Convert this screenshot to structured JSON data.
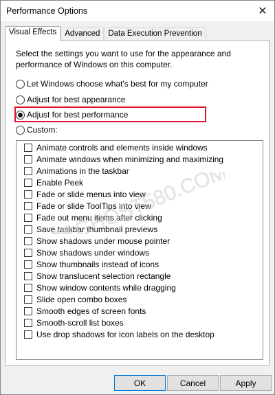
{
  "window": {
    "title": "Performance Options",
    "close_glyph": "✕"
  },
  "tabs": [
    {
      "label": "Visual Effects",
      "active": true
    },
    {
      "label": "Advanced",
      "active": false
    },
    {
      "label": "Data Execution Prevention",
      "active": false
    }
  ],
  "panel": {
    "description": "Select the settings you want to use for the appearance and performance of Windows on this computer.",
    "radios": [
      {
        "label": "Let Windows choose what's best for my computer",
        "checked": false
      },
      {
        "label": "Adjust for best appearance",
        "checked": false
      },
      {
        "label": "Adjust for best performance",
        "checked": true
      },
      {
        "label": "Custom:",
        "checked": false
      }
    ],
    "highlight_color": "#e0112b",
    "options": [
      {
        "label": "Animate controls and elements inside windows",
        "checked": false
      },
      {
        "label": "Animate windows when minimizing and maximizing",
        "checked": false
      },
      {
        "label": "Animations in the taskbar",
        "checked": false
      },
      {
        "label": "Enable Peek",
        "checked": false
      },
      {
        "label": "Fade or slide menus into view",
        "checked": false
      },
      {
        "label": "Fade or slide ToolTips into view",
        "checked": false
      },
      {
        "label": "Fade out menu items after clicking",
        "checked": false
      },
      {
        "label": "Save taskbar thumbnail previews",
        "checked": false
      },
      {
        "label": "Show shadows under mouse pointer",
        "checked": false
      },
      {
        "label": "Show shadows under windows",
        "checked": false
      },
      {
        "label": "Show thumbnails instead of icons",
        "checked": false
      },
      {
        "label": "Show translucent selection rectangle",
        "checked": false
      },
      {
        "label": "Show window contents while dragging",
        "checked": false
      },
      {
        "label": "Slide open combo boxes",
        "checked": false
      },
      {
        "label": "Smooth edges of screen fonts",
        "checked": false
      },
      {
        "label": "Smooth-scroll list boxes",
        "checked": false
      },
      {
        "label": "Use drop shadows for icon labels on the desktop",
        "checked": false
      }
    ]
  },
  "buttons": {
    "ok": "OK",
    "cancel": "Cancel",
    "apply": "Apply"
  },
  "watermark": {
    "text": "GHOST580.COM",
    "logo_icon": "windows-logo-icon"
  }
}
